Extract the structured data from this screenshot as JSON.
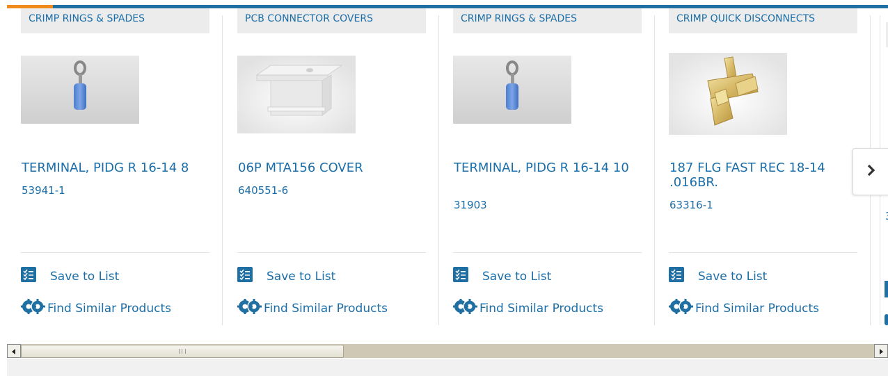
{
  "carousel": {
    "cards": [
      {
        "category": "CRIMP RINGS & SPADES",
        "name": "TERMINAL, PIDG R 16-14 8",
        "part_number": "53941-1",
        "image": "ring-terminal"
      },
      {
        "category": "PCB CONNECTOR COVERS",
        "name": "06P MTA156 COVER",
        "part_number": "640551-6",
        "image": "connector-cover"
      },
      {
        "category": "CRIMP RINGS & SPADES",
        "name": "TERMINAL, PIDG R 16-14 10",
        "part_number": "31903",
        "image": "ring-terminal"
      },
      {
        "category": "CRIMP QUICK DISCONNECTS",
        "name": "187 FLG FAST REC 18-14 .016BR.",
        "part_number": "63316-1",
        "image": "quick-disconnect"
      }
    ],
    "actions": {
      "save_label": "Save to List",
      "find_label": "Find Similar Products"
    },
    "partial_card_part_prefix": "3",
    "next_icon": "chevron-right-icon"
  },
  "colors": {
    "accent": "#f08a1c",
    "brand": "#1f6fa3",
    "link": "#1b6ea8",
    "category_bg": "#ececec"
  }
}
